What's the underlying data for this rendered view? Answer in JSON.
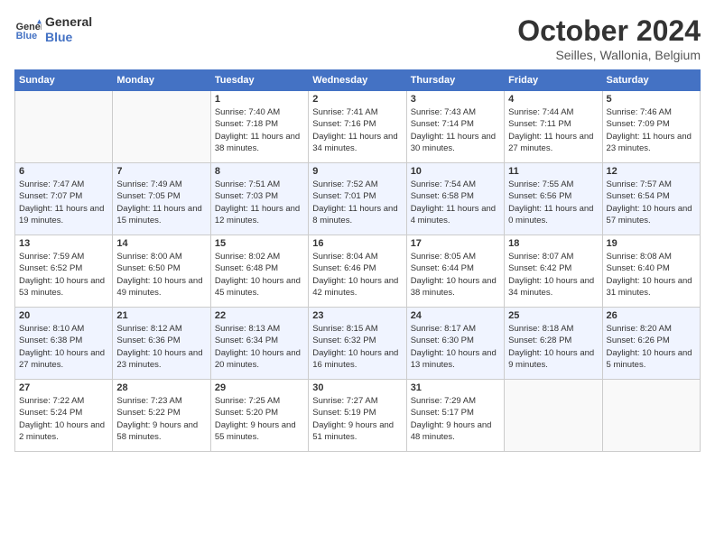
{
  "header": {
    "logo_line1": "General",
    "logo_line2": "Blue",
    "month": "October 2024",
    "location": "Seilles, Wallonia, Belgium"
  },
  "columns": [
    "Sunday",
    "Monday",
    "Tuesday",
    "Wednesday",
    "Thursday",
    "Friday",
    "Saturday"
  ],
  "weeks": [
    [
      {
        "day": "",
        "info": ""
      },
      {
        "day": "",
        "info": ""
      },
      {
        "day": "1",
        "sunrise": "7:40 AM",
        "sunset": "7:18 PM",
        "daylight": "11 hours and 38 minutes."
      },
      {
        "day": "2",
        "sunrise": "7:41 AM",
        "sunset": "7:16 PM",
        "daylight": "11 hours and 34 minutes."
      },
      {
        "day": "3",
        "sunrise": "7:43 AM",
        "sunset": "7:14 PM",
        "daylight": "11 hours and 30 minutes."
      },
      {
        "day": "4",
        "sunrise": "7:44 AM",
        "sunset": "7:11 PM",
        "daylight": "11 hours and 27 minutes."
      },
      {
        "day": "5",
        "sunrise": "7:46 AM",
        "sunset": "7:09 PM",
        "daylight": "11 hours and 23 minutes."
      }
    ],
    [
      {
        "day": "6",
        "sunrise": "7:47 AM",
        "sunset": "7:07 PM",
        "daylight": "11 hours and 19 minutes."
      },
      {
        "day": "7",
        "sunrise": "7:49 AM",
        "sunset": "7:05 PM",
        "daylight": "11 hours and 15 minutes."
      },
      {
        "day": "8",
        "sunrise": "7:51 AM",
        "sunset": "7:03 PM",
        "daylight": "11 hours and 12 minutes."
      },
      {
        "day": "9",
        "sunrise": "7:52 AM",
        "sunset": "7:01 PM",
        "daylight": "11 hours and 8 minutes."
      },
      {
        "day": "10",
        "sunrise": "7:54 AM",
        "sunset": "6:58 PM",
        "daylight": "11 hours and 4 minutes."
      },
      {
        "day": "11",
        "sunrise": "7:55 AM",
        "sunset": "6:56 PM",
        "daylight": "11 hours and 0 minutes."
      },
      {
        "day": "12",
        "sunrise": "7:57 AM",
        "sunset": "6:54 PM",
        "daylight": "10 hours and 57 minutes."
      }
    ],
    [
      {
        "day": "13",
        "sunrise": "7:59 AM",
        "sunset": "6:52 PM",
        "daylight": "10 hours and 53 minutes."
      },
      {
        "day": "14",
        "sunrise": "8:00 AM",
        "sunset": "6:50 PM",
        "daylight": "10 hours and 49 minutes."
      },
      {
        "day": "15",
        "sunrise": "8:02 AM",
        "sunset": "6:48 PM",
        "daylight": "10 hours and 45 minutes."
      },
      {
        "day": "16",
        "sunrise": "8:04 AM",
        "sunset": "6:46 PM",
        "daylight": "10 hours and 42 minutes."
      },
      {
        "day": "17",
        "sunrise": "8:05 AM",
        "sunset": "6:44 PM",
        "daylight": "10 hours and 38 minutes."
      },
      {
        "day": "18",
        "sunrise": "8:07 AM",
        "sunset": "6:42 PM",
        "daylight": "10 hours and 34 minutes."
      },
      {
        "day": "19",
        "sunrise": "8:08 AM",
        "sunset": "6:40 PM",
        "daylight": "10 hours and 31 minutes."
      }
    ],
    [
      {
        "day": "20",
        "sunrise": "8:10 AM",
        "sunset": "6:38 PM",
        "daylight": "10 hours and 27 minutes."
      },
      {
        "day": "21",
        "sunrise": "8:12 AM",
        "sunset": "6:36 PM",
        "daylight": "10 hours and 23 minutes."
      },
      {
        "day": "22",
        "sunrise": "8:13 AM",
        "sunset": "6:34 PM",
        "daylight": "10 hours and 20 minutes."
      },
      {
        "day": "23",
        "sunrise": "8:15 AM",
        "sunset": "6:32 PM",
        "daylight": "10 hours and 16 minutes."
      },
      {
        "day": "24",
        "sunrise": "8:17 AM",
        "sunset": "6:30 PM",
        "daylight": "10 hours and 13 minutes."
      },
      {
        "day": "25",
        "sunrise": "8:18 AM",
        "sunset": "6:28 PM",
        "daylight": "10 hours and 9 minutes."
      },
      {
        "day": "26",
        "sunrise": "8:20 AM",
        "sunset": "6:26 PM",
        "daylight": "10 hours and 5 minutes."
      }
    ],
    [
      {
        "day": "27",
        "sunrise": "7:22 AM",
        "sunset": "5:24 PM",
        "daylight": "10 hours and 2 minutes."
      },
      {
        "day": "28",
        "sunrise": "7:23 AM",
        "sunset": "5:22 PM",
        "daylight": "9 hours and 58 minutes."
      },
      {
        "day": "29",
        "sunrise": "7:25 AM",
        "sunset": "5:20 PM",
        "daylight": "9 hours and 55 minutes."
      },
      {
        "day": "30",
        "sunrise": "7:27 AM",
        "sunset": "5:19 PM",
        "daylight": "9 hours and 51 minutes."
      },
      {
        "day": "31",
        "sunrise": "7:29 AM",
        "sunset": "5:17 PM",
        "daylight": "9 hours and 48 minutes."
      },
      {
        "day": "",
        "info": ""
      },
      {
        "day": "",
        "info": ""
      }
    ]
  ]
}
